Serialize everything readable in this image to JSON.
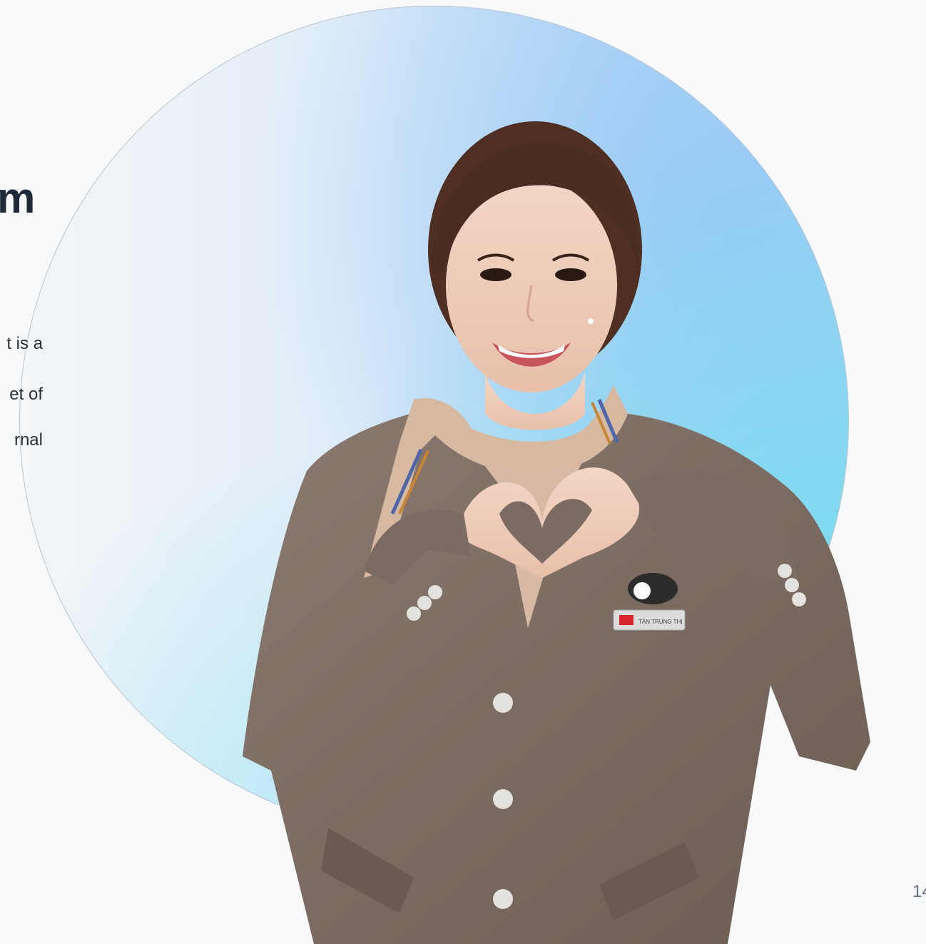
{
  "slide": {
    "heading_fragment": "m",
    "body_line_fragments": [
      "t is a",
      "et of",
      "rnal"
    ],
    "page_number": "14",
    "photo": {
      "subject": "flight-attendant-making-heart-gesture",
      "badge_text": "TÂN TRUNG THỊ"
    }
  },
  "colors": {
    "background": "#f7f9fb",
    "heading": "#1e2a3a",
    "body_text": "#2b2f36",
    "circle_left": "#f4f6f8",
    "circle_right": "#9fd5f3",
    "uniform_jacket": "#7b6b62",
    "scarf": "#d6b9a0"
  }
}
